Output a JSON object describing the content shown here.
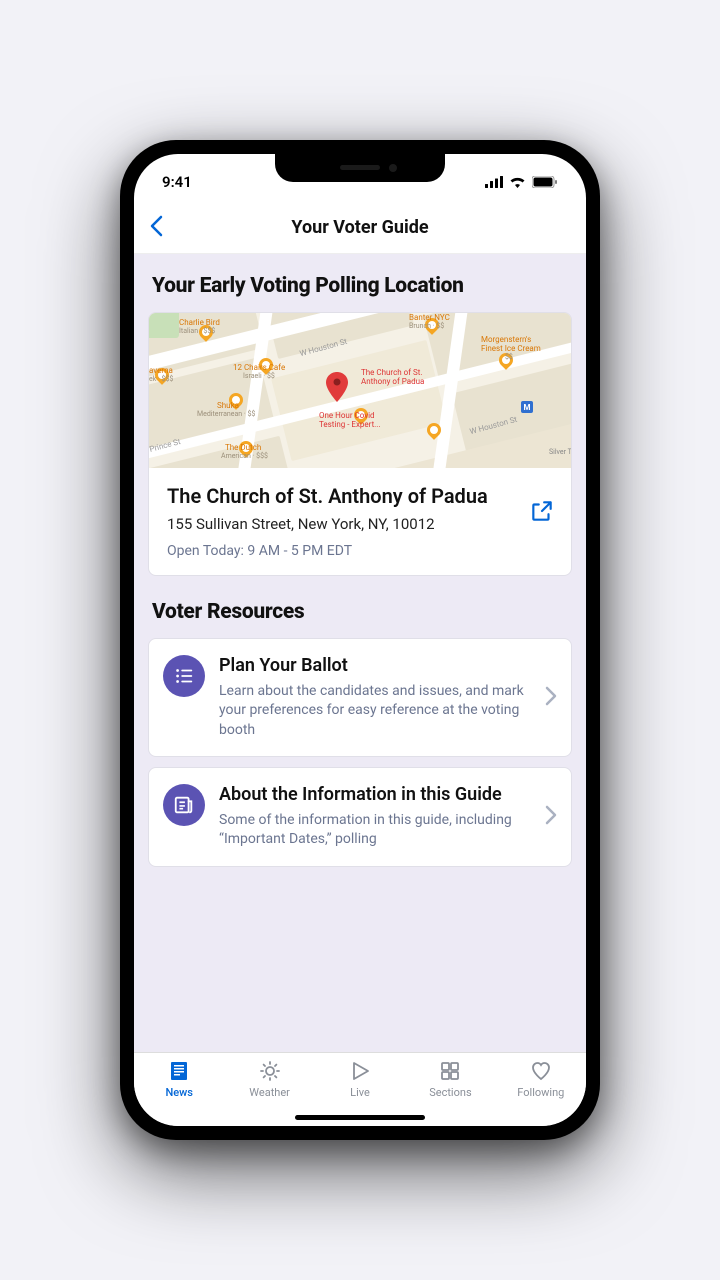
{
  "status": {
    "time": "9:41"
  },
  "nav": {
    "title": "Your Voter Guide"
  },
  "polling": {
    "heading": "Your Early Voting Polling Location",
    "location_name": "The Church of St. Anthony of Padua",
    "address": "155 Sullivan Street, New York, NY, 10012",
    "hours": "Open Today: 9 AM - 5 PM EDT",
    "map_pois": {
      "charlie_bird": "Charlie Bird",
      "charlie_bird_sub": "Italian · $$$",
      "twelve_chairs": "12 Chairs Cafe",
      "twelve_chairs_sub": "Israeli · $$",
      "shuka": "Shuka",
      "shuka_sub": "Mediterranean · $$",
      "averna": "averna",
      "averna_sub": "ek · $$$",
      "dutch": "The Dutch",
      "dutch_sub": "American · $$$",
      "banter": "Banter NYC",
      "banter_sub": "Brunch · $$",
      "morgenstern": "Morgenstern's\nFinest Ice Cream",
      "morgenstern_sub": "$$",
      "testing": "One Hour Covid\nTesting - Expert...",
      "center": "The Church of St.\nAnthony of Padua",
      "silver": "Silver Towe",
      "houston": "W Houston St",
      "prince": "Prince St"
    }
  },
  "resources": {
    "heading": "Voter Resources",
    "items": [
      {
        "title": "Plan Your Ballot",
        "desc": "Learn about the candidates and issues, and mark your preferences for easy reference at the voting booth"
      },
      {
        "title": "About the Information in this Guide",
        "desc": "Some of the information in this guide, including “Important Dates,” polling"
      }
    ]
  },
  "tabs": {
    "news": "News",
    "weather": "Weather",
    "live": "Live",
    "sections": "Sections",
    "following": "Following"
  }
}
